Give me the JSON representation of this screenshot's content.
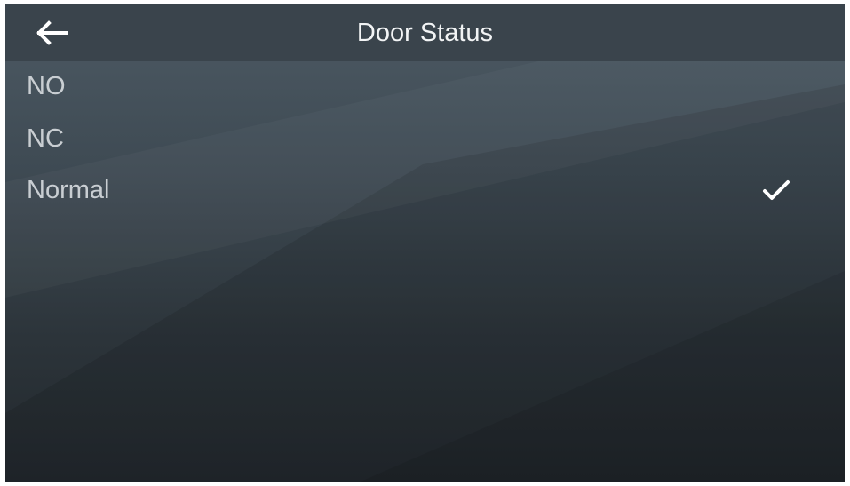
{
  "header": {
    "title": "Door Status",
    "back_icon": "arrow-left-icon"
  },
  "options": [
    {
      "label": "NO",
      "selected": false
    },
    {
      "label": "NC",
      "selected": false
    },
    {
      "label": "Normal",
      "selected": true
    }
  ],
  "colors": {
    "header_bg": "#3a444c",
    "text_primary": "#f2f4f5",
    "text_option": "#c9ced2",
    "check": "#ffffff"
  }
}
